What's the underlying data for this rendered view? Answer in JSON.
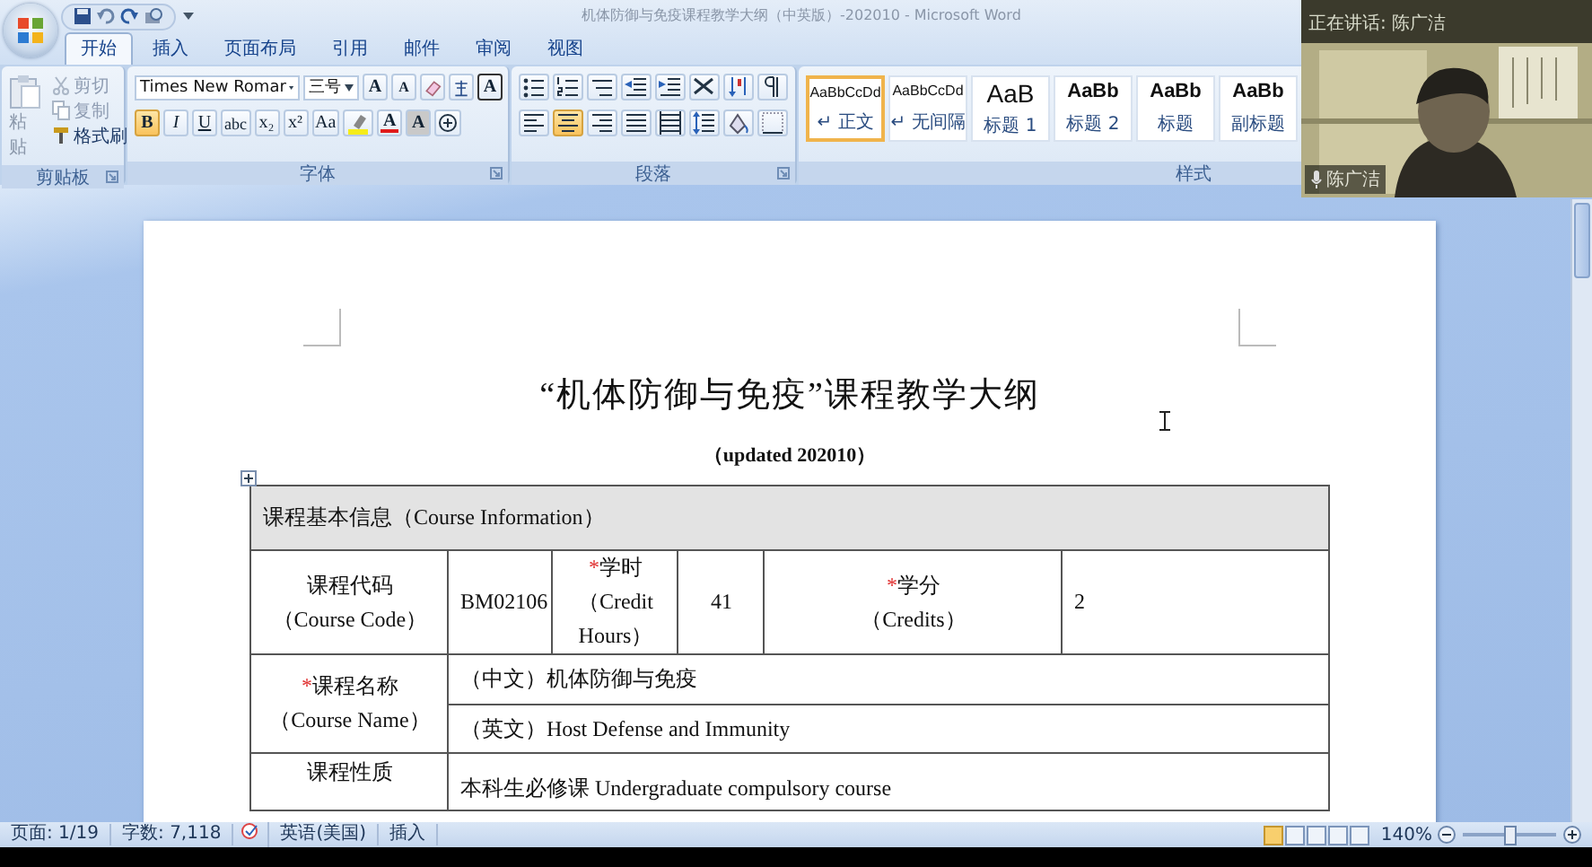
{
  "window": {
    "title": "机体防御与免疫课程教学大纲（中英版）-202010 - Microsoft Word"
  },
  "tabs": [
    {
      "label": "开始",
      "selected": true
    },
    {
      "label": "插入",
      "selected": false
    },
    {
      "label": "页面布局",
      "selected": false
    },
    {
      "label": "引用",
      "selected": false
    },
    {
      "label": "邮件",
      "selected": false
    },
    {
      "label": "审阅",
      "selected": false
    },
    {
      "label": "视图",
      "selected": false
    }
  ],
  "clipboard": {
    "label": "剪贴板",
    "paste": "粘贴",
    "tools": [
      {
        "label": "剪切",
        "disabled": true
      },
      {
        "label": "复制",
        "disabled": true
      },
      {
        "label": "格式刷",
        "disabled": false
      }
    ]
  },
  "font": {
    "label": "字体",
    "name": "Times New Romar",
    "size": "三号",
    "row1": [
      {
        "label": "A",
        "pressed": false
      },
      {
        "label": "A",
        "pressed": false
      },
      {
        "label": "A",
        "pressed": false
      }
    ],
    "row2": [
      {
        "label": "B",
        "pressed": true
      },
      {
        "label": "I",
        "pressed": false
      },
      {
        "label": "U",
        "pressed": false
      },
      {
        "label": "abc",
        "pressed": false
      },
      {
        "label": "x₂",
        "pressed": false
      },
      {
        "label": "x²",
        "pressed": false
      },
      {
        "label": "Aa",
        "pressed": false
      },
      {
        "label": "A",
        "pressed": false
      },
      {
        "label": "A",
        "pressed": false
      }
    ]
  },
  "paragraph": {
    "label": "段落",
    "alignments": [
      {
        "selected": false
      },
      {
        "selected": true
      },
      {
        "selected": false
      },
      {
        "selected": false
      },
      {
        "selected": false
      }
    ]
  },
  "styles": {
    "label": "样式",
    "items": [
      {
        "kind": "body",
        "sample": "AaBbCcDd",
        "label": "↵ 正文",
        "selected": true
      },
      {
        "kind": "body",
        "sample": "AaBbCcDd",
        "label": "↵ 无间隔",
        "selected": false
      },
      {
        "kind": "heading1",
        "sample": "AaB",
        "label": "标题 1",
        "selected": false
      },
      {
        "kind": "heading",
        "sample": "AaBb",
        "label": "标题 2",
        "selected": false
      },
      {
        "kind": "heading",
        "sample": "AaBb",
        "label": "标题",
        "selected": false
      },
      {
        "kind": "heading",
        "sample": "AaBb",
        "label": "副标题",
        "selected": false
      }
    ]
  },
  "video": {
    "status": "正在讲话: 陈广洁",
    "speaker": "陈广洁"
  },
  "document": {
    "title": "“机体防御与免疫”课程教学大纲",
    "subtitle": "（updated 202010）",
    "table": {
      "header": "课程基本信息（Course Information）",
      "code_row": [
        {
          "lines": [
            "课程代码",
            "（Course Code）"
          ]
        },
        {
          "lines": [
            "BM02106"
          ]
        },
        {
          "mark": "*",
          "lines": [
            "学时",
            "（Credit",
            "Hours）"
          ]
        },
        {
          "lines": [
            "41"
          ]
        },
        {
          "mark": "*",
          "lines": [
            "学分",
            "（Credits）"
          ]
        },
        {
          "lines": [
            "2"
          ]
        }
      ],
      "name_row": {
        "label": {
          "mark": "*",
          "lines": [
            "课程名称",
            "（Course Name）"
          ]
        },
        "values": [
          "（中文）机体防御与免疫",
          "（英文）Host Defense and Immunity"
        ]
      },
      "nature_row": {
        "label": "课程性质",
        "value": "本科生必修课 Undergraduate compulsory course"
      }
    }
  },
  "status_bar": {
    "page": "页面: 1/19",
    "words": "字数: 7,118",
    "language": "英语(美国)",
    "mode": "插入",
    "zoom": "140%",
    "zoom_slider": {
      "level": 0.5
    }
  }
}
